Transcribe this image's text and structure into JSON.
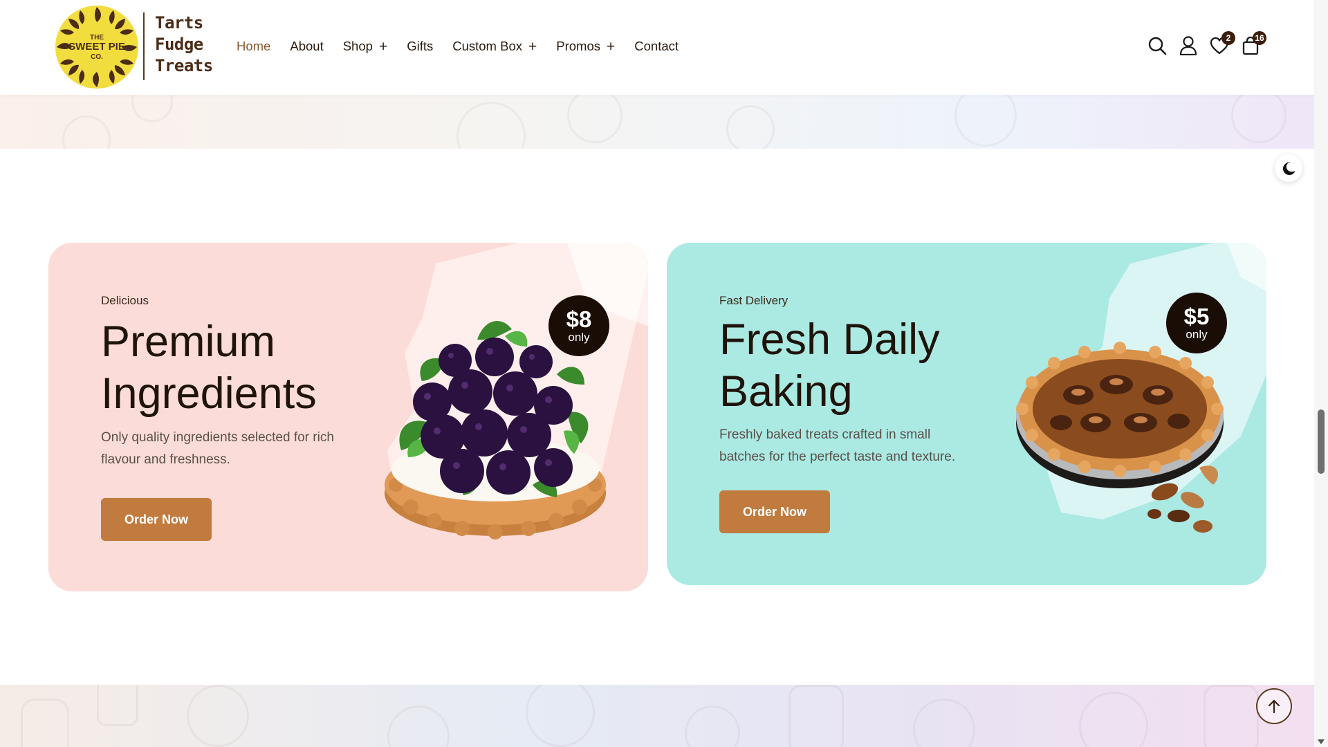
{
  "brand": {
    "logo_text": "THE SWEET PIE CO.",
    "tagline": [
      "Tarts",
      "Fudge",
      "Treats"
    ]
  },
  "nav": {
    "items": [
      {
        "label": "Home",
        "active": true,
        "has_submenu": false
      },
      {
        "label": "About",
        "active": false,
        "has_submenu": false
      },
      {
        "label": "Shop",
        "active": false,
        "has_submenu": true
      },
      {
        "label": "Gifts",
        "active": false,
        "has_submenu": false
      },
      {
        "label": "Custom Box",
        "active": false,
        "has_submenu": true
      },
      {
        "label": "Promos",
        "active": false,
        "has_submenu": true
      },
      {
        "label": "Contact",
        "active": false,
        "has_submenu": false
      }
    ],
    "submenu_glyph": "+"
  },
  "header_icons": {
    "search": "search-icon",
    "account": "user-icon",
    "wishlist": {
      "icon": "heart-icon",
      "count": "2"
    },
    "cart": {
      "icon": "bag-icon",
      "count": "16"
    }
  },
  "cards": [
    {
      "eyebrow": "Delicious",
      "title": "Premium Ingredients",
      "title_lines": [
        "Premium",
        "Ingredients"
      ],
      "description_lines": [
        "Only quality ingredients selected for rich",
        "flavour and freshness."
      ],
      "button": "Order Now",
      "price": "$8",
      "price_suffix": "only",
      "background": "#fcdcd8",
      "image": "blackberry-tart-image"
    },
    {
      "eyebrow": "Fast Delivery",
      "title": "Fresh Daily Baking",
      "title_lines": [
        "Fresh Daily",
        "Baking"
      ],
      "description_lines": [
        "Freshly baked treats crafted in small",
        "batches for the perfect taste and texture."
      ],
      "button": "Order Now",
      "price": "$5",
      "price_suffix": "only",
      "background": "#abe9e3",
      "image": "pecan-tart-image"
    }
  ],
  "colors": {
    "accent": "#c17b3f",
    "dark_brown": "#1a0d06",
    "nav_active": "#8a5a2e"
  },
  "utility": {
    "dark_mode_toggle": "moon-icon",
    "scroll_top": "arrow-up-icon"
  }
}
